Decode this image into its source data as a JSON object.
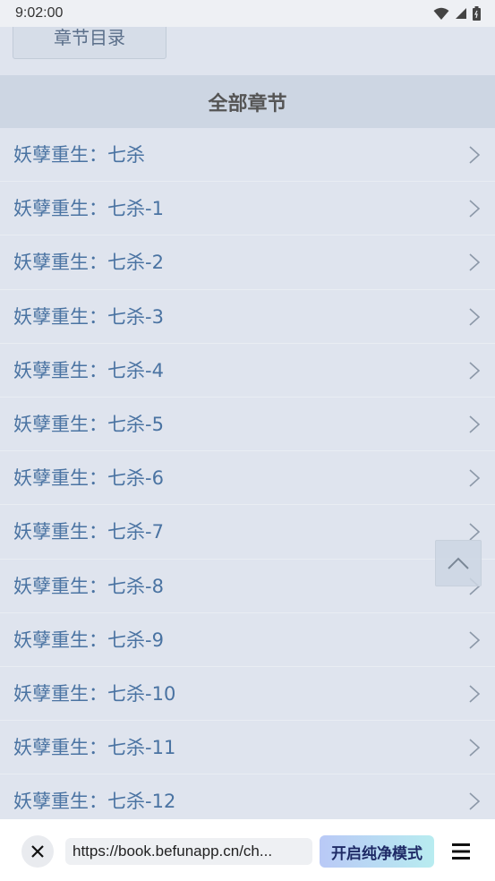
{
  "status_bar": {
    "time": "9:02:00",
    "icons": [
      "wifi-icon",
      "signal-icon",
      "battery-icon"
    ]
  },
  "page": {
    "catalog_button_label": "章节目录",
    "section_title": "全部章节",
    "chapters": [
      {
        "label": "妖孽重生：七杀"
      },
      {
        "label": "妖孽重生：七杀-1"
      },
      {
        "label": "妖孽重生：七杀-2"
      },
      {
        "label": "妖孽重生：七杀-3"
      },
      {
        "label": "妖孽重生：七杀-4"
      },
      {
        "label": "妖孽重生：七杀-5"
      },
      {
        "label": "妖孽重生：七杀-6"
      },
      {
        "label": "妖孽重生：七杀-7"
      },
      {
        "label": "妖孽重生：七杀-8"
      },
      {
        "label": "妖孽重生：七杀-9"
      },
      {
        "label": "妖孽重生：七杀-10"
      },
      {
        "label": "妖孽重生：七杀-11"
      },
      {
        "label": "妖孽重生：七杀-12"
      }
    ],
    "back_to_top_icon": "chevron-up-icon"
  },
  "browser_bar": {
    "url": "https://book.befunapp.cn/ch...",
    "pure_mode_label": "开启纯净模式",
    "close_icon": "close-icon",
    "menu_icon": "menu-icon"
  },
  "colors": {
    "page_bg": "#dfe4ee",
    "header_bg": "#cdd6e3",
    "link_text": "#4a73a2"
  }
}
